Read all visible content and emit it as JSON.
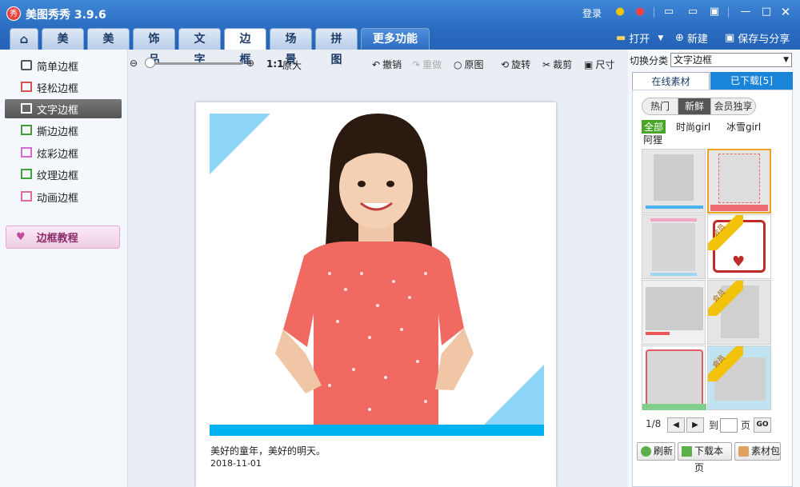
{
  "app": {
    "title": "美图秀秀 3.9.6",
    "logo_text": "秀",
    "login": "登录"
  },
  "tabs": [
    {
      "label": "美化"
    },
    {
      "label": "美容"
    },
    {
      "label": "饰品"
    },
    {
      "label": "文字"
    },
    {
      "label": "边框"
    },
    {
      "label": "场景"
    },
    {
      "label": "拼图"
    },
    {
      "label": "更多功能"
    }
  ],
  "top_actions": {
    "open": "打开",
    "new": "新建",
    "save": "保存与分享"
  },
  "sidebar": {
    "items": [
      {
        "label": "简单边框"
      },
      {
        "label": "轻松边框"
      },
      {
        "label": "文字边框"
      },
      {
        "label": "撕边边框"
      },
      {
        "label": "炫彩边框"
      },
      {
        "label": "纹理边框"
      },
      {
        "label": "动画边框"
      }
    ],
    "tutorial": "边框教程"
  },
  "toolbar": {
    "ratio": "1:1",
    "original_size": "原大",
    "undo": "撤销",
    "redo": "重做",
    "original": "原图",
    "rotate": "旋转",
    "crop": "裁剪",
    "size": "尺寸"
  },
  "canvas": {
    "caption": "美好的童年，美好的明天。",
    "date": "2018-11-01"
  },
  "right": {
    "switch_label": "切换分类",
    "category": "文字边框",
    "tab_online": "在线素材",
    "tab_downloaded": "已下载[5]",
    "pills": [
      "热门",
      "新鲜",
      "会员独享"
    ],
    "filters": [
      "全部",
      "时尚girl",
      "冰雪girl",
      "阿狸"
    ],
    "vip_badge": "会员",
    "page": "1/8",
    "goto": "到",
    "page_unit": "页",
    "go": "GO",
    "refresh": "刷新",
    "download_page": "下载本页",
    "material_pack": "素材包"
  },
  "colors": {
    "accent": "#2a6cc0",
    "frame_blue": "#8ed6f8",
    "frame_bar": "#00b2f0",
    "dress": "#f06a62"
  }
}
